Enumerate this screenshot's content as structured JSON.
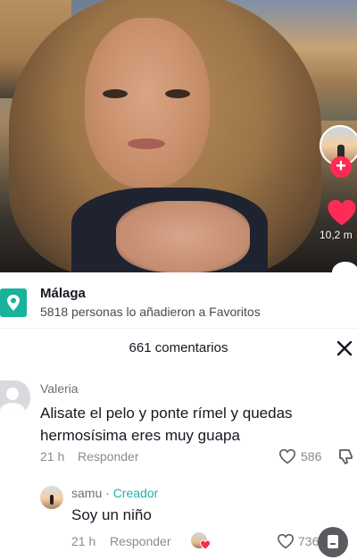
{
  "video": {
    "like_count": "10,2 m"
  },
  "location": {
    "name": "Málaga",
    "favorites_text": "5818 personas lo añadieron a Favoritos"
  },
  "comments_header": {
    "count_label": "661 comentarios"
  },
  "comments": [
    {
      "author": "Valeria",
      "text": "Alisate el pelo y ponte rímel y quedas hermosísima eres muy guapa",
      "time": "21 h",
      "reply_label": "Responder",
      "likes": "586"
    }
  ],
  "replies": [
    {
      "author": "samu",
      "separator": "·",
      "badge": "Creador",
      "text": "Soy un niño",
      "time": "21 h",
      "reply_label": "Responder",
      "likes": "736"
    }
  ],
  "colors": {
    "like_red": "#fe2c55",
    "creator_teal": "#20b2aa",
    "location_green": "#18b39a"
  },
  "icons": [
    "heart-icon",
    "plus-icon",
    "location-pin-icon",
    "close-icon",
    "heart-outline-icon",
    "dislike-icon",
    "document-icon"
  ]
}
